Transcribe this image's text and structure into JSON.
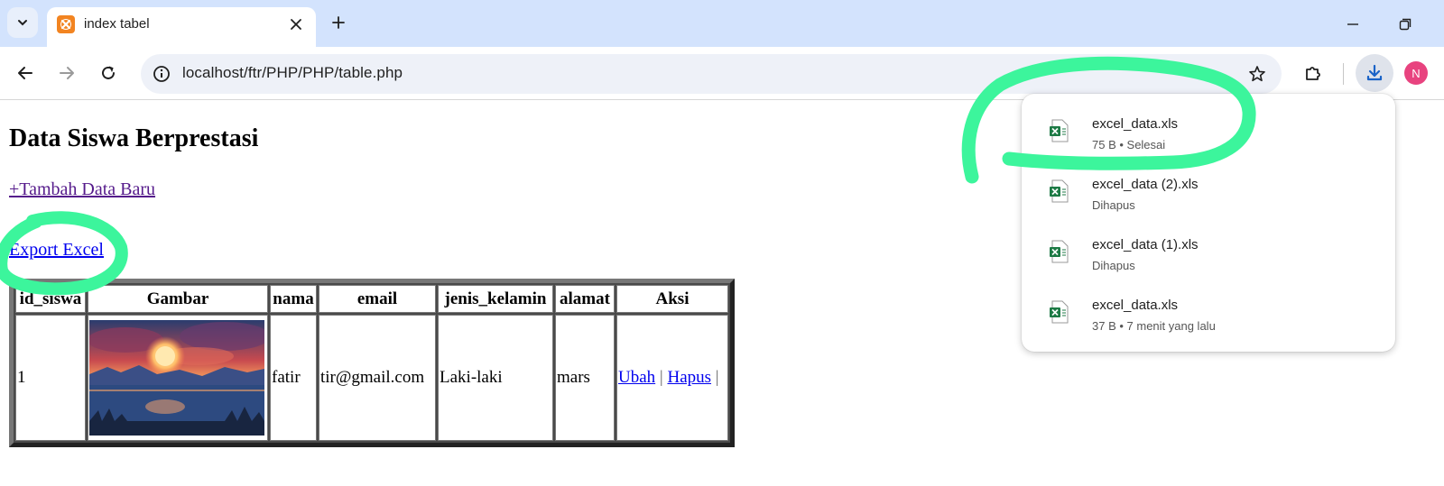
{
  "browser": {
    "tab_title": "index tabel",
    "url": "localhost/ftr/PHP/PHP/table.php",
    "profile_initial": "N",
    "accent_color": "#d3e3fd"
  },
  "page": {
    "heading": "Data Siswa Berprestasi",
    "add_link": "+Tambah Data Baru",
    "export_link": "Export Excel",
    "table": {
      "headers": [
        "id_siswa",
        "Gambar",
        "nama",
        "email",
        "jenis_kelamin",
        "alamat",
        "Aksi"
      ],
      "rows": [
        {
          "id_siswa": "1",
          "nama": "fatir",
          "email": "tir@gmail.com",
          "jenis_kelamin": "Laki-laki",
          "alamat": "mars",
          "edit_label": "Ubah",
          "separator": "|",
          "delete_label": "Hapus",
          "trailing": "|"
        }
      ]
    }
  },
  "downloads": [
    {
      "name": "excel_data.xls",
      "status": "75 B • Selesai"
    },
    {
      "name": "excel_data (2).xls",
      "status": "Dihapus"
    },
    {
      "name": "excel_data (1).xls",
      "status": "Dihapus"
    },
    {
      "name": "excel_data.xls",
      "status": "37 B • 7 menit yang lalu"
    }
  ],
  "colors": {
    "annotation": "#3cf59c",
    "excel_icon": "#1d7a45",
    "link": "#0000ee",
    "visited_link": "#551a8b"
  }
}
